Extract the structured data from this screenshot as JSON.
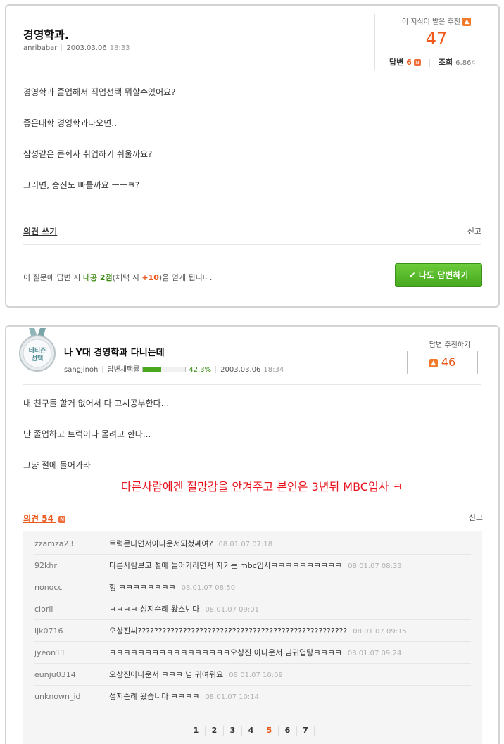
{
  "question": {
    "title": "경영학과.",
    "author": "anribabar",
    "date": "2003.03.06",
    "time": "18:33",
    "rec_label": "이 지식이 받은 추천",
    "rec_count": "47",
    "answers_label": "답변",
    "answers_count": "6",
    "views_label": "조회",
    "views_count": "6,864",
    "new_badge": "N",
    "body": [
      "경영학과 졸업해서 직업선택 뭐할수있어요?",
      "좋은대학 경영학과나오면..",
      "삼성같은 큰회사 취업하기 쉬울까요?",
      "그러면, 승진도 빠를까요 ㅡㅡㅋ?"
    ],
    "opinion_label": "의견 쓰기",
    "report_label": "신고",
    "notice_prefix": "이 질문에 답변 시 ",
    "notice_points": "내공 2점",
    "notice_mid": "(채택 시 ",
    "notice_bonus": "+10",
    "notice_suffix": ")을 얻게 됩니다.",
    "answer_button": "나도 답변하기"
  },
  "answer": {
    "medal_text": "네티즌 선택",
    "title": "나 Y대 경영학과 다니는데",
    "author": "sangjinoh",
    "adopt_label": "답변채택률",
    "adopt_rate": 0.423,
    "adopt_pct": "42.3%",
    "date": "2003.03.06",
    "time": "18:34",
    "rec_label": "답변 추천하기",
    "rec_count": "46",
    "body": [
      "내 친구들 할거 없어서 다 고시공부한다...",
      "난 졸업하고 트럭이나 몰려고 한다...",
      "그냥 절에 들어가라"
    ],
    "overlay_text": "다른사람에겐 절망감을 안겨주고 본인은 3년뒤 MBC입사 ㅋ",
    "comments_label": "의견 54",
    "new_badge": "N",
    "report_label": "신고",
    "comments": [
      {
        "user": "zzamza23",
        "text": "트럭몬다면서아나운서되셨쎄여?",
        "time": "08.01.07 07:18"
      },
      {
        "user": "92khr",
        "text": "다른사람보고 절에 들어가라면서 자기는 mbc입사ㅋㅋㅋㅋㅋㅋㅋㅋㅋㅋ",
        "time": "08.01.07 08:33"
      },
      {
        "user": "nonocc",
        "text": "헝 ㅋㅋㅋㅋㅋㅋㅋㅋ",
        "time": "08.01.07 08:50"
      },
      {
        "user": "clorii",
        "text": "ㅋㅋㅋㅋ 성지순례 왔스빈다",
        "time": "08.01.07 09:01"
      },
      {
        "user": "ljk0716",
        "text": "오상진씨???????????????????????????????????????????????????",
        "time": "08.01.07 09:15"
      },
      {
        "user": "jyeon11",
        "text": "ㅋㅋㅋㅋㅋㅋㅋㅋㅋㅋㅋㅋㅋㅋㅋㅋㅋ오상진 아나운서 님귀엽탕ㅋㅋㅋㅋ",
        "time": "08.01.07 09:24"
      },
      {
        "user": "eunju0314",
        "text": "오상진아나운서 ㅋㅋㅋ 넘 귀여워요",
        "time": "08.01.07 10:09"
      },
      {
        "user": "unknown_id",
        "text": "성지순례 왔습니다 ㅋㅋㅋㅋ",
        "time": "08.01.07 10:14"
      }
    ],
    "pages": [
      "1",
      "2",
      "3",
      "4",
      "5",
      "6",
      "7"
    ],
    "current_page": "5"
  }
}
